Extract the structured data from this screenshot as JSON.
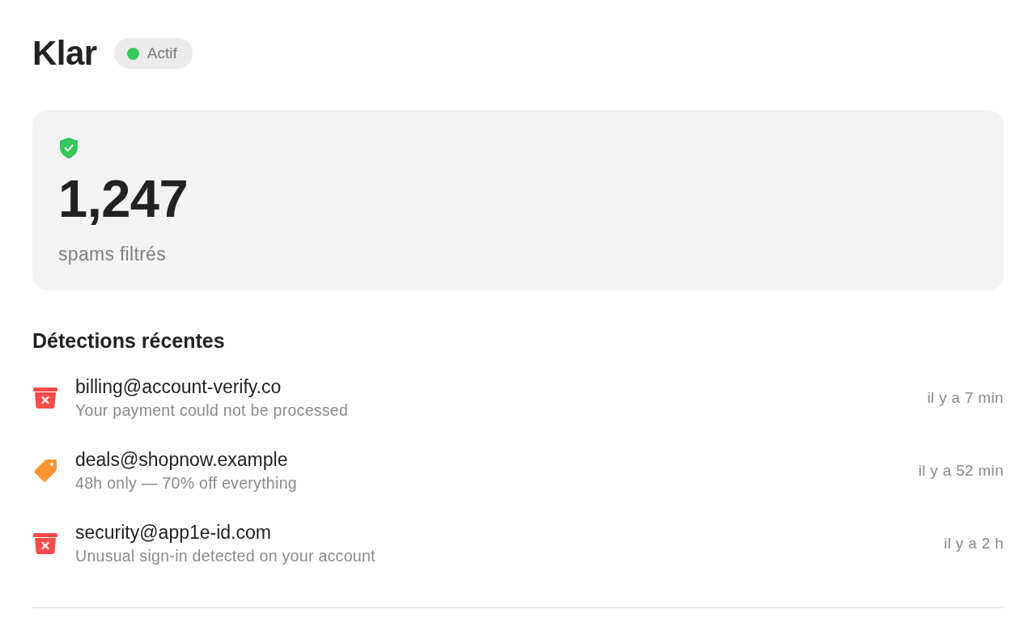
{
  "header": {
    "title": "Klar",
    "status": {
      "label": "Actif",
      "on": true
    }
  },
  "summary": {
    "count": "1,247",
    "caption": "spams filtrés"
  },
  "recent": {
    "heading": "Détections récentes",
    "items": [
      {
        "kind": "phishing",
        "sender": "billing@account-verify.co",
        "subject": "Your payment could not be processed",
        "time": "il y a 7 min"
      },
      {
        "kind": "promo",
        "sender": "deals@shopnow.example",
        "subject": "48h only — 70% off everything",
        "time": "il y a 52 min"
      },
      {
        "kind": "phishing",
        "sender": "security@app1e-id.com",
        "subject": "Unusual sign-in detected on your account",
        "time": "il y a 2 h"
      }
    ]
  }
}
